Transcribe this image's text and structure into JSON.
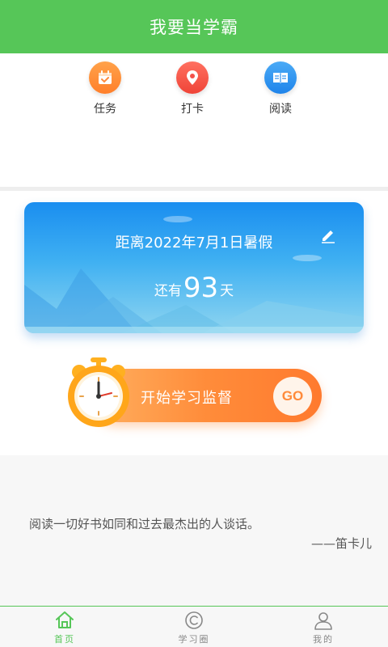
{
  "header": {
    "title": "我要当学霸"
  },
  "quick_actions": [
    {
      "label": "任务",
      "icon": "calendar-task-icon",
      "color": "#ff8a3a"
    },
    {
      "label": "打卡",
      "icon": "location-pin-icon",
      "color": "#f4514a"
    },
    {
      "label": "阅读",
      "icon": "open-book-icon",
      "color": "#2d8ff0"
    }
  ],
  "countdown": {
    "title": "距离2022年7月1日暑假",
    "prefix": "还有",
    "days": "93",
    "suffix": "天"
  },
  "start_button": {
    "label": "开始学习监督",
    "go": "GO"
  },
  "quote": {
    "text": "阅读一切好书如同和过去最杰出的人谈话。",
    "author": "——笛卡儿"
  },
  "tabs": [
    {
      "label": "首页",
      "icon": "home-icon",
      "active": true
    },
    {
      "label": "学习圈",
      "icon": "study-circle-icon",
      "active": false
    },
    {
      "label": "我的",
      "icon": "user-icon",
      "active": false
    }
  ],
  "colors": {
    "brand": "#56c658",
    "accent": "#ff8a3a",
    "card": "#1a8ef0"
  }
}
